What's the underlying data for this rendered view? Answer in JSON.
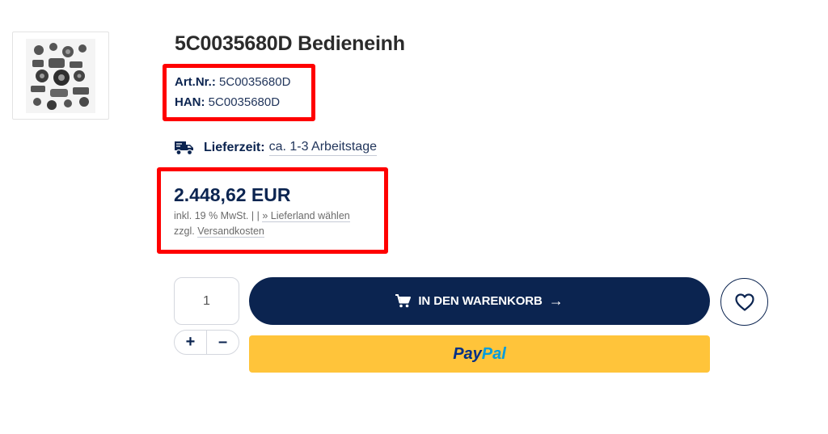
{
  "product": {
    "title": "5C0035680D Bedieneinh",
    "image_alt": "engine-parts-image",
    "art_nr_label": "Art.Nr.:",
    "art_nr_value": "5C0035680D",
    "han_label": "HAN:",
    "han_value": "5C0035680D"
  },
  "delivery": {
    "label": "Lieferzeit:",
    "value": "ca. 1-3 Arbeitstage"
  },
  "pricing": {
    "price": "2.448,62 EUR",
    "tax_text": "inkl. 19 % MwSt. | | ",
    "country_link": "» Lieferland wählen",
    "shipping_prefix": "zzgl. ",
    "shipping_link": "Versandkosten"
  },
  "quantity": {
    "value": "1",
    "plus": "+",
    "minus": "–"
  },
  "actions": {
    "cart_label": "IN DEN WARENKORB",
    "cart_arrow": "→",
    "paypal_part1": "Pay",
    "paypal_part2": "Pal"
  },
  "colors": {
    "navy": "#0b2450",
    "highlight": "#ff0000",
    "paypal_yellow": "#ffc43a"
  }
}
